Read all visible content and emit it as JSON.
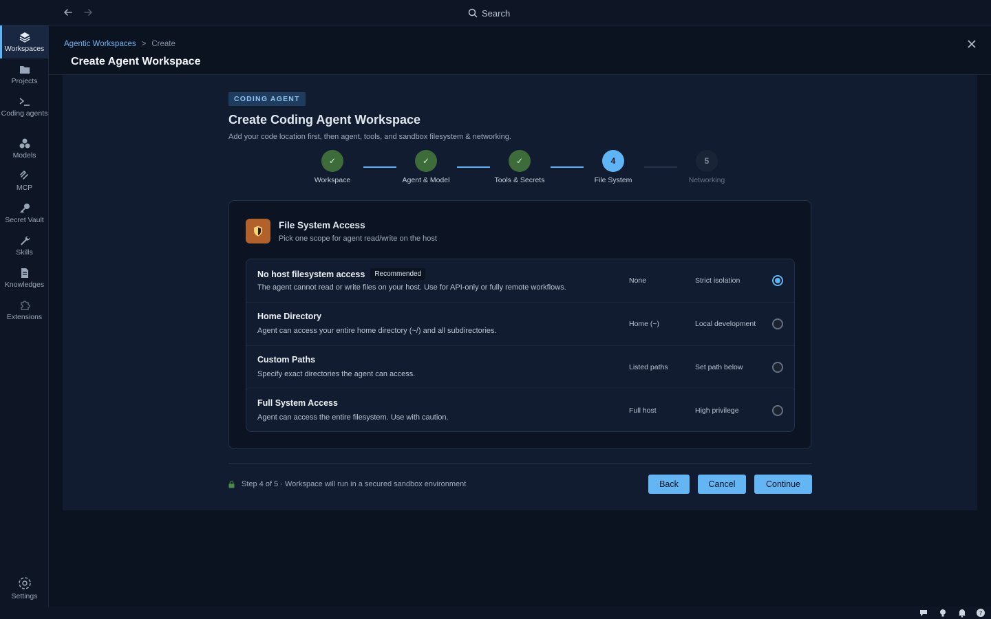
{
  "topbar": {
    "search_label": "Search",
    "back_icon": "arrow-left-icon",
    "forward_icon": "arrow-right-icon"
  },
  "sidebar": {
    "items": [
      {
        "label": "Workspaces",
        "icon": "layers-icon",
        "active": true
      },
      {
        "label": "Projects",
        "icon": "folder-icon"
      },
      {
        "label": "Coding agents",
        "icon": "terminal-icon"
      },
      {
        "label": "Models",
        "icon": "cubes-icon"
      },
      {
        "label": "MCP",
        "icon": "mcp-icon"
      },
      {
        "label": "Secret Vault",
        "icon": "key-icon"
      },
      {
        "label": "Skills",
        "icon": "wrench-icon"
      },
      {
        "label": "Knowledges",
        "icon": "document-icon"
      },
      {
        "label": "Extensions",
        "icon": "puzzle-icon"
      }
    ],
    "settings_label": "Settings"
  },
  "header": {
    "breadcrumb_link": "Agentic Workspaces",
    "breadcrumb_sep": ">",
    "breadcrumb_current": "Create",
    "title": "Create Agent Workspace"
  },
  "form": {
    "badge": "CODING AGENT",
    "title": "Create Coding Agent Workspace",
    "subtitle": "Add your code location first, then agent, tools, and sandbox filesystem & networking."
  },
  "steps": [
    {
      "num": "✓",
      "label": "Workspace",
      "state": "done"
    },
    {
      "num": "✓",
      "label": "Agent & Model",
      "state": "done"
    },
    {
      "num": "✓",
      "label": "Tools & Secrets",
      "state": "done"
    },
    {
      "num": "4",
      "label": "File System",
      "state": "current"
    },
    {
      "num": "5",
      "label": "Networking",
      "state": "todo"
    }
  ],
  "card": {
    "title": "File System Access",
    "subtitle": "Pick one scope for agent read/write on the host",
    "options": [
      {
        "title": "No host filesystem access",
        "tag": "Recommended",
        "desc": "The agent cannot read or write files on your host. Use for API-only or fully remote workflows.",
        "scope": "None",
        "note": "Strict isolation",
        "selected": true
      },
      {
        "title": "Home Directory",
        "desc": "Agent can access your entire home directory (~/) and all subdirectories.",
        "scope": "Home (~)",
        "note": "Local development",
        "selected": false
      },
      {
        "title": "Custom Paths",
        "desc": "Specify exact directories the agent can access.",
        "scope": "Listed paths",
        "note": "Set path below",
        "selected": false
      },
      {
        "title": "Full System Access",
        "desc": "Agent can access the entire filesystem. Use with caution.",
        "scope": "Full host",
        "note": "High privilege",
        "selected": false
      }
    ]
  },
  "footer": {
    "note": "Step 4 of 5 · Workspace will run in a secured sandbox environment",
    "back": "Back",
    "cancel": "Cancel",
    "continue": "Continue"
  },
  "colors": {
    "accent": "#5fb4f5",
    "done": "#3d6b3a",
    "shield": "#b3612b",
    "background": "#0b1220"
  }
}
